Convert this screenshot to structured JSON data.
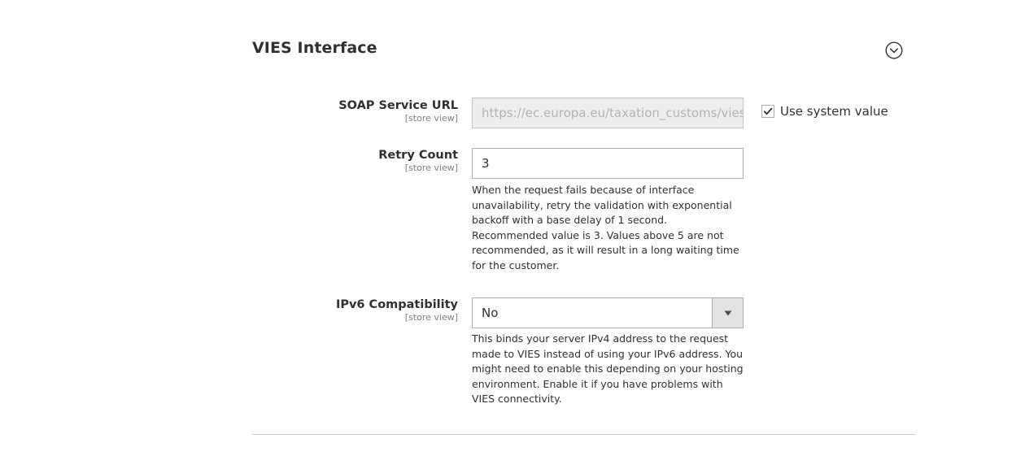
{
  "section": {
    "title": "VIES Interface"
  },
  "fields": {
    "soap_url": {
      "label": "SOAP Service URL",
      "scope": "[store view]",
      "value": "https://ec.europa.eu/taxation_customs/vies/checkVatService.wsdl",
      "use_system_value_label": "Use system value",
      "use_system_value_checked": true
    },
    "retry_count": {
      "label": "Retry Count",
      "scope": "[store view]",
      "value": "3",
      "note_lines": [
        "When the request fails because of interface",
        "unavailability, retry the validation with exponential",
        "backoff with a base delay of 1 second.",
        "Recommended value is 3. Values above 5 are not",
        "recommended, as it will result in a long waiting time",
        "for the customer."
      ]
    },
    "ipv6": {
      "label": "IPv6 Compatibility",
      "scope": "[store view]",
      "selected": "No",
      "note_lines": [
        "This binds your server IPv4 address to the request",
        "made to VIES instead of using your IPv6 address. You",
        "might need to enable this depending on your hosting",
        "environment. Enable it if you have problems with",
        "VIES connectivity."
      ]
    }
  },
  "icons": {
    "collapse": "chevron-down-circle-icon",
    "checkbox": "checkmark-icon",
    "select": "triangle-down-icon"
  }
}
